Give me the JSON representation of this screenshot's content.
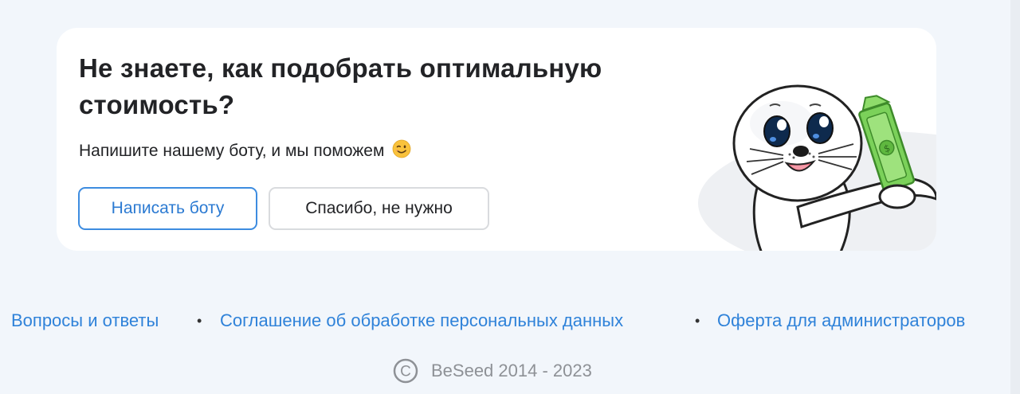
{
  "promo": {
    "title": "Не знаете, как подобрать оптимальную стоимость?",
    "subtitle": "Напишите нашему боту, и мы поможем",
    "emoji_icon": "winking-face-emoji",
    "primary_button": "Написать боту",
    "secondary_button": "Спасибо, не нужно",
    "illustration": "seal-mascot-holding-money",
    "colors": {
      "accent": "#2b7ad2",
      "button_border": "#3d8ce0",
      "money": "#6cc24a"
    }
  },
  "footer": {
    "links": [
      "Вопросы и ответы",
      "Соглашение об обработке персональных данных",
      "Оферта для администраторов"
    ],
    "separator": "•",
    "copyright_icon": "copyright-icon",
    "copyright_text": "BeSeed 2014 - 2023"
  }
}
